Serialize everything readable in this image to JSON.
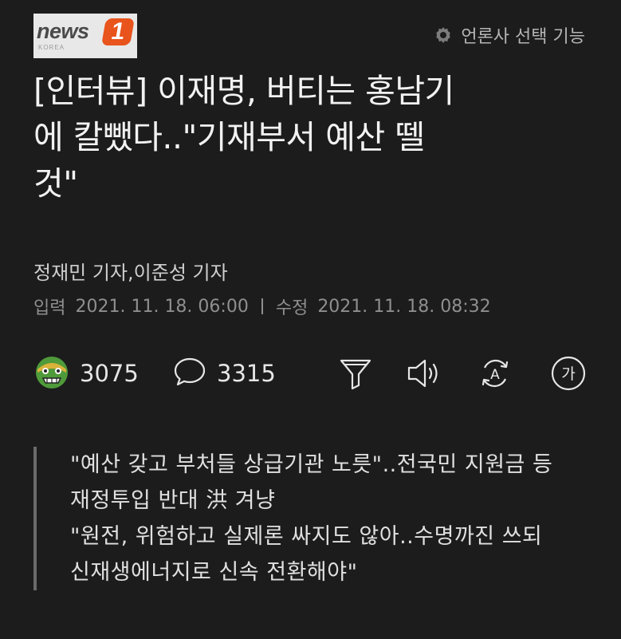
{
  "brand": {
    "word": "news",
    "badge": "1",
    "sub": "KOREA"
  },
  "header": {
    "press_select_label": "언론사 선택 기능"
  },
  "article": {
    "title_lines": [
      "[인터뷰] 이재명, 버티는 홍남기",
      "에 칼뺐다..\"기재부서 예산 뗄",
      "것\""
    ],
    "reporters": "정재민 기자,이준성 기자",
    "published_label": "입력",
    "published": "2021. 11. 18. 06:00",
    "modified_label": "수정",
    "modified": "2021. 11. 18. 08:32"
  },
  "toolbar": {
    "reaction_count": "3075",
    "comment_count": "3315",
    "icons": [
      "reaction-emoji-icon",
      "comment-icon",
      "summary-filter-icon",
      "audio-speaker-icon",
      "translate-icon",
      "font-size-icon"
    ],
    "font_size_glyph": "가",
    "translate_glyph": "A"
  },
  "summary": {
    "lines": [
      "\"예산 갖고 부처들 상급기관 노릇\"..전국민 지원금 등 재정투입 반대 洪 겨냥",
      "\"원전, 위험하고 실제론 싸지도 않아..수명까진 쓰되 신재생에너지로 신속 전환해야\""
    ]
  },
  "colors": {
    "background": "#1c1c1c",
    "brand_accent": "#e8541b",
    "reaction_face": "#4f9a3a"
  }
}
